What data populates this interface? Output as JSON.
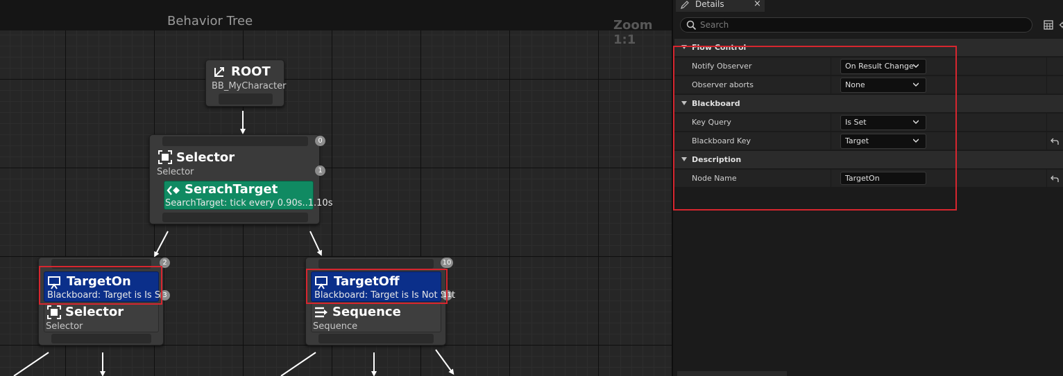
{
  "graph": {
    "title": "Behavior Tree",
    "zoom": "Zoom 1:1",
    "nodes": {
      "root": {
        "title": "ROOT",
        "subtitle": "BB_MyCharacter"
      },
      "selector_main": {
        "title": "Selector",
        "subtitle": "Selector",
        "badge_top": "0",
        "badge_mid": "1"
      },
      "search_target": {
        "title": "SerachTarget",
        "subtitle": "SearchTarget: tick every 0.90s..1.10s"
      },
      "left": {
        "decorator_title": "TargetOn",
        "decorator_subtitle": "Blackboard: Target is Is Set",
        "title": "Selector",
        "subtitle": "Selector",
        "badge_top": "2",
        "badge_mid": "3"
      },
      "right": {
        "decorator_title": "TargetOff",
        "decorator_subtitle": "Blackboard: Target is Is Not Set",
        "title": "Sequence",
        "subtitle": "Sequence",
        "badge_top": "10",
        "badge_mid": "11"
      }
    }
  },
  "details": {
    "tab_label": "Details",
    "tab_close": "×",
    "search_placeholder": "Search",
    "categories": {
      "flow_control": "Flow Control",
      "blackboard": "Blackboard",
      "description": "Description"
    },
    "props": {
      "notify_observer": {
        "label": "Notify Observer",
        "value": "On Result Change"
      },
      "observer_aborts": {
        "label": "Observer aborts",
        "value": "None"
      },
      "key_query": {
        "label": "Key Query",
        "value": "Is Set"
      },
      "blackboard_key": {
        "label": "Blackboard Key",
        "value": "Target"
      },
      "node_name": {
        "label": "Node Name",
        "value": "TargetOn"
      }
    }
  },
  "colors": {
    "task_green": "#108a62",
    "decorator_blue": "#0b2f8a",
    "highlight_red": "#d7262f"
  }
}
